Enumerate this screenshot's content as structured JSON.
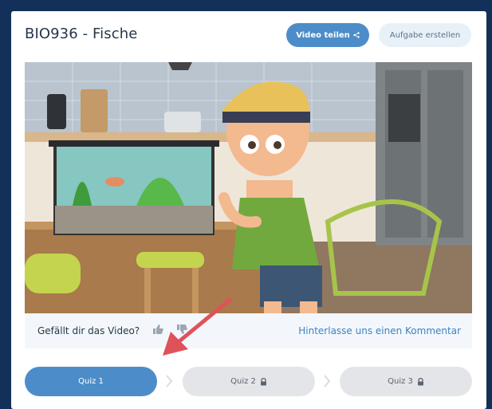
{
  "header": {
    "title": "BIO936 - Fische",
    "share_button": "Video teilen",
    "task_button": "Aufgabe erstellen"
  },
  "video": {
    "description": "Animated boy with headband looking at an aquarium in a kitchen"
  },
  "feedback": {
    "question": "Gefällt dir das Video?",
    "comment_link": "Hinterlasse uns einen Kommentar"
  },
  "quizzes": [
    {
      "label": "Quiz 1",
      "locked": false
    },
    {
      "label": "Quiz 2",
      "locked": true
    },
    {
      "label": "Quiz 3",
      "locked": true
    }
  ],
  "colors": {
    "frame": "#12305a",
    "accent": "#4c8dc9",
    "link": "#3d82c4",
    "locked": "#e3e5e8",
    "arrow": "#e0525a"
  }
}
